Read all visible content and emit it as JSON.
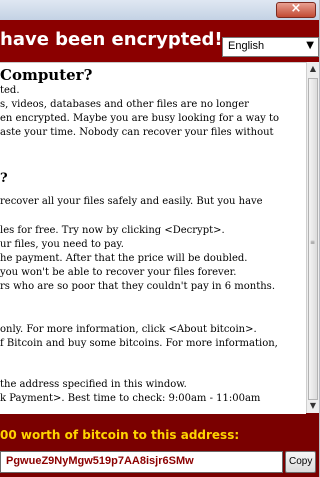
{
  "header": {
    "title": "have been encrypted!",
    "language": "English"
  },
  "content": {
    "heading1": "Computer?",
    "p1": [
      "ted.",
      "s, videos, databases and other files are no longer",
      "en encrypted. Maybe you are busy looking for a way to",
      "aste your time. Nobody can recover your files without"
    ],
    "heading2": "?",
    "p2": [
      "recover all your files safely and easily. But you have"
    ],
    "p3": [
      "les for free. Try now by clicking <Decrypt>.",
      "ur files, you need to pay.",
      "he payment. After that the price will be doubled.",
      "you won't be able to recover your files forever.",
      "rs who are so poor that they couldn't pay in 6 months."
    ],
    "p4": [
      "only. For more information, click <About bitcoin>.",
      "f Bitcoin and buy some bitcoins. For more information,"
    ],
    "p5": [
      "the address specified in this window.",
      "k Payment>. Best time to check: 9:00am - 11:00am"
    ]
  },
  "footer": {
    "send_label": "00 worth of bitcoin to this address:",
    "address": "PgwueZ9NyMgw519p7AA8isjr6SMw",
    "copy_label": "Copy"
  },
  "window": {
    "close_glyph": "×"
  },
  "colors": {
    "frame": "#8b0000",
    "accent_text": "#ffd400"
  }
}
